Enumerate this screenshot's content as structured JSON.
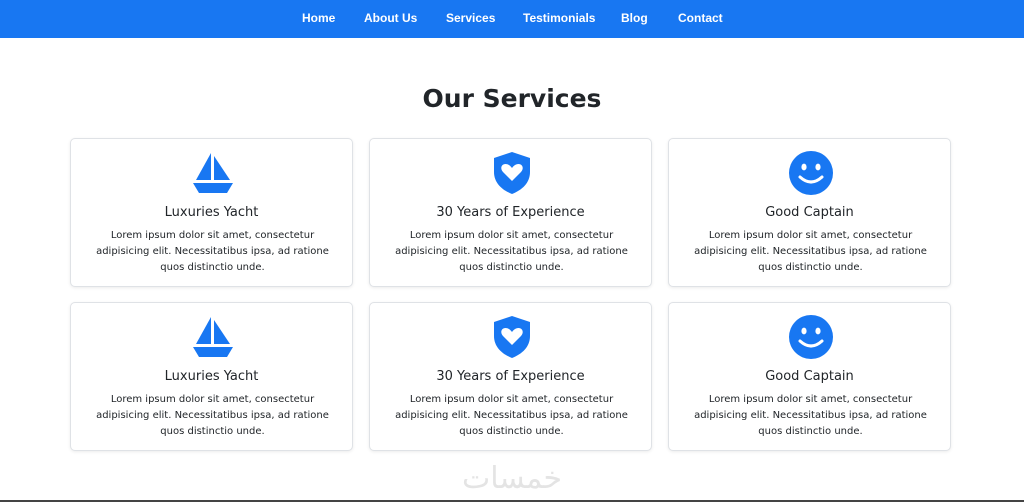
{
  "nav": {
    "items": [
      {
        "label": "Home"
      },
      {
        "label": "About Us"
      },
      {
        "label": "Services"
      },
      {
        "label": "Testimonials"
      },
      {
        "label": "Blog"
      },
      {
        "label": "Contact"
      }
    ]
  },
  "services": {
    "title": "Our Services",
    "cards": [
      {
        "icon": "sailboat-icon",
        "title": "Luxuries Yacht",
        "text": "Lorem ipsum dolor sit amet, consectetur adipisicing elit. Necessitatibus ipsa, ad ratione quos distinctio unde."
      },
      {
        "icon": "shield-heart-icon",
        "title": "30 Years of Experience",
        "text": "Lorem ipsum dolor sit amet, consectetur adipisicing elit. Necessitatibus ipsa, ad ratione quos distinctio unde."
      },
      {
        "icon": "smiley-icon",
        "title": "Good Captain",
        "text": "Lorem ipsum dolor sit amet, consectetur adipisicing elit. Necessitatibus ipsa, ad ratione quos distinctio unde."
      },
      {
        "icon": "sailboat-icon",
        "title": "Luxuries Yacht",
        "text": "Lorem ipsum dolor sit amet, consectetur adipisicing elit. Necessitatibus ipsa, ad ratione quos distinctio unde."
      },
      {
        "icon": "shield-heart-icon",
        "title": "30 Years of Experience",
        "text": "Lorem ipsum dolor sit amet, consectetur adipisicing elit. Necessitatibus ipsa, ad ratione quos distinctio unde."
      },
      {
        "icon": "smiley-icon",
        "title": "Good Captain",
        "text": "Lorem ipsum dolor sit amet, consectetur adipisicing elit. Necessitatibus ipsa, ad ratione quos distinctio unde."
      }
    ]
  },
  "watermark": {
    "text": "خمسات"
  },
  "colors": {
    "accent": "#1877f2",
    "navbar": "#1877f2",
    "text": "#212529",
    "card_border": "#dfe2e6"
  }
}
